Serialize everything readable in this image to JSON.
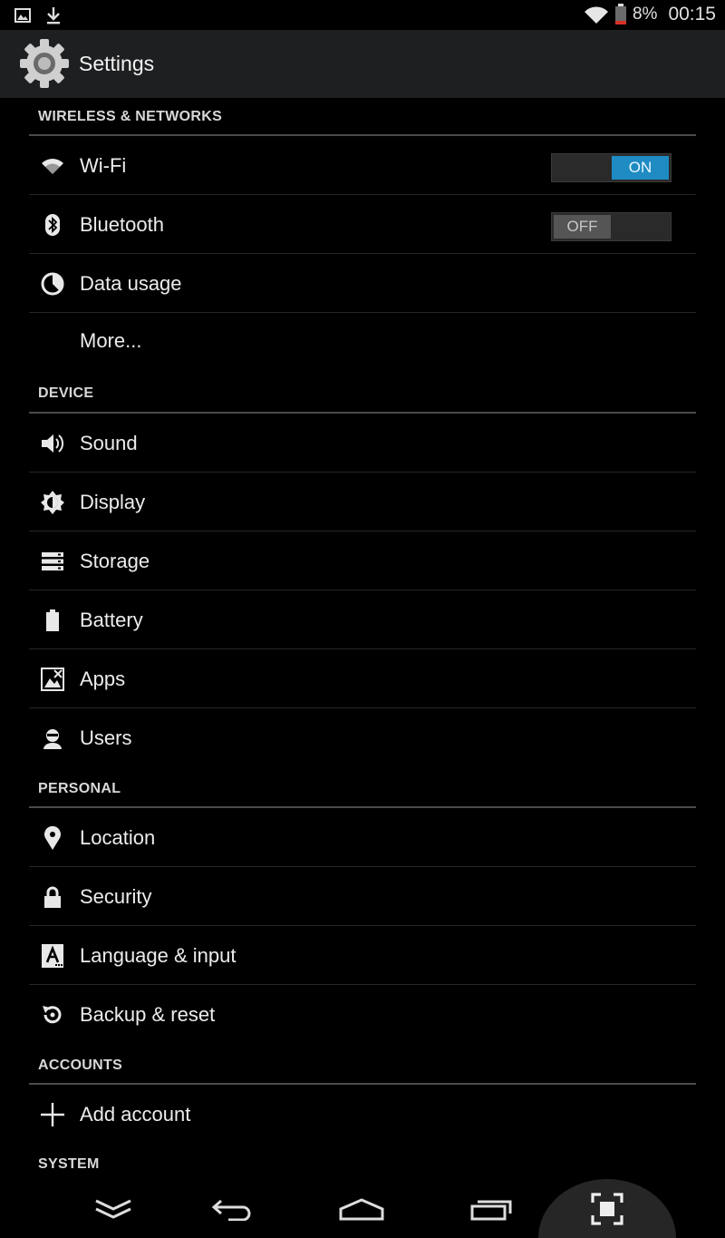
{
  "status_bar": {
    "battery_percent": "8%",
    "time": "00:15",
    "left_icons": [
      "image-icon",
      "download-icon"
    ],
    "right_icons": [
      "wifi-icon",
      "battery-icon"
    ]
  },
  "action_bar": {
    "title": "Settings",
    "icon": "settings-gear-icon"
  },
  "sections": [
    {
      "header": "WIRELESS & NETWORKS",
      "items": [
        {
          "label": "Wi-Fi",
          "icon": "wifi-icon",
          "toggle": "ON"
        },
        {
          "label": "Bluetooth",
          "icon": "bluetooth-icon",
          "toggle": "OFF"
        },
        {
          "label": "Data usage",
          "icon": "data-usage-icon"
        },
        {
          "label": "More..."
        }
      ]
    },
    {
      "header": "DEVICE",
      "items": [
        {
          "label": "Sound",
          "icon": "speaker-icon"
        },
        {
          "label": "Display",
          "icon": "brightness-icon"
        },
        {
          "label": "Storage",
          "icon": "storage-icon"
        },
        {
          "label": "Battery",
          "icon": "battery-icon"
        },
        {
          "label": "Apps",
          "icon": "apps-icon"
        },
        {
          "label": "Users",
          "icon": "user-icon"
        }
      ]
    },
    {
      "header": "PERSONAL",
      "items": [
        {
          "label": "Location",
          "icon": "location-pin-icon"
        },
        {
          "label": "Security",
          "icon": "lock-icon"
        },
        {
          "label": "Language & input",
          "icon": "language-icon"
        },
        {
          "label": "Backup & reset",
          "icon": "backup-icon"
        }
      ]
    },
    {
      "header": "ACCOUNTS",
      "items": [
        {
          "label": "Add account",
          "icon": "plus-icon"
        }
      ]
    },
    {
      "header": "SYSTEM",
      "items": []
    }
  ],
  "nav_bar": [
    "collapse-icon",
    "back-icon",
    "home-icon",
    "recents-icon",
    "screenshot-icon"
  ],
  "colors": {
    "background": "#000000",
    "action_bar": "#1e1f21",
    "accent": "#1e8bc3",
    "battery_low": "#d93025"
  }
}
